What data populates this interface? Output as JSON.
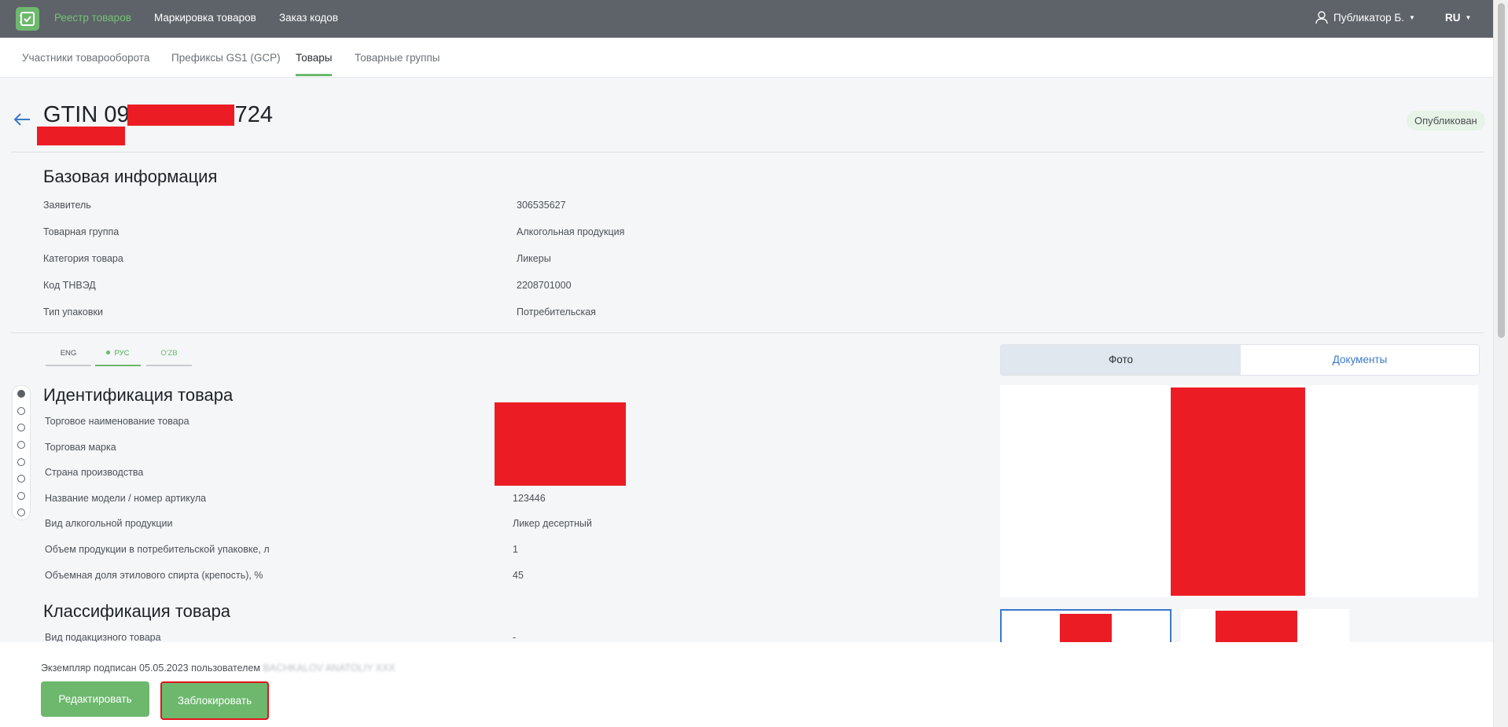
{
  "header": {
    "nav": [
      "Реестр товаров",
      "Маркировка товаров",
      "Заказ кодов"
    ],
    "user": "Публикатор Б.",
    "language": "RU"
  },
  "subnav": [
    "Участники товарооборота",
    "Префиксы GS1 (GCP)",
    "Товары",
    "Товарные группы"
  ],
  "page": {
    "title_start": "GTIN 09",
    "title_end": "724",
    "status": "Опубликован"
  },
  "basic": {
    "title": "Базовая информация",
    "rows": [
      {
        "label": "Заявитель",
        "value": "306535627"
      },
      {
        "label": "Товарная группа",
        "value": "Алкогольная продукция"
      },
      {
        "label": "Категория товара",
        "value": "Ликеры"
      },
      {
        "label": "Код ТНВЭД",
        "value": "2208701000"
      },
      {
        "label": "Тип упаковки",
        "value": "Потребительская"
      }
    ]
  },
  "lang_tabs": [
    "ENG",
    "РУС",
    "O'ZB"
  ],
  "identification": {
    "title": "Идентификация товара",
    "rows": [
      {
        "label": "Торговое наименование товара",
        "value": ""
      },
      {
        "label": "Торговая марка",
        "value": ""
      },
      {
        "label": "Страна производства",
        "value": ""
      },
      {
        "label": "Название модели / номер артикула",
        "value": "123446"
      },
      {
        "label": "Вид алкогольной продукции",
        "value": "Ликер десертный"
      },
      {
        "label": "Объем продукции в потребительской упаковке, л",
        "value": "1"
      },
      {
        "label": "Объемная доля этилового спирта (крепость), %",
        "value": "45"
      }
    ]
  },
  "classification": {
    "title": "Классификация товара",
    "rows": [
      {
        "label": "Вид подакцизного товара",
        "value": "-"
      }
    ]
  },
  "media_tabs": [
    "Фото",
    "Документы"
  ],
  "footer": {
    "signed_text": "Экземпляр подписан 05.05.2023 пользователем",
    "signed_user": "BACHKALOV ANATOLIY XXX",
    "edit_button": "Редактировать",
    "block_button": "Заблокировать"
  },
  "colors": {
    "accent": "#6db86d",
    "topbar": "#5e6369",
    "redaction": "#ec1c24",
    "link": "#3a79c8"
  }
}
